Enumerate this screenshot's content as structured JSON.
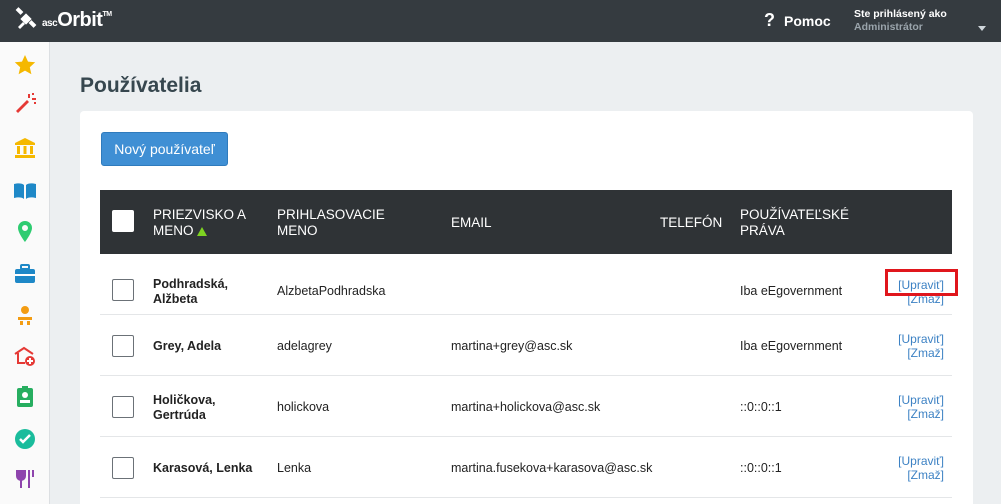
{
  "app": {
    "logo_prefix": "asc",
    "logo_main": "Orbit",
    "logo_tm": "TM"
  },
  "header": {
    "help_label": "Pomoc",
    "user_label": "Ste prihlásený ako",
    "user_name": "Administrátor"
  },
  "sidebar": {
    "items": [
      "star-icon",
      "magic-wand-icon",
      "bank-icon",
      "open-book-icon",
      "location-pin-icon",
      "briefcase-icon",
      "person-desk-icon",
      "school-add-icon",
      "id-badge-icon",
      "check-circle-icon",
      "cup-fork-icon"
    ]
  },
  "page": {
    "title": "Používatelia",
    "new_user_button": "Nový používateľ"
  },
  "table": {
    "headers": {
      "name": "PRIEZVISKO A MENO",
      "login": "PRIHLASOVACIE MENO",
      "email": "EMAIL",
      "phone": "TELEFÓN",
      "rights": "POUŽÍVATEĽSKÉ PRÁVA"
    },
    "rows": [
      {
        "name": "Podhradská, Alžbeta",
        "login": "AlzbetaPodhradska",
        "email": "",
        "phone": "",
        "rights": "Iba eEgovernment",
        "edit": "[Upraviť]",
        "delete": "[Zmaž]"
      },
      {
        "name": "Grey, Adela",
        "login": "adelagrey",
        "email": "martina+grey@asc.sk",
        "phone": "",
        "rights": "Iba eEgovernment",
        "edit": "[Upraviť]",
        "delete": "[Zmaž]"
      },
      {
        "name": "Holičkova, Gertrúda",
        "login": "holickova",
        "email": "martina+holickova@asc.sk",
        "phone": "",
        "rights": "::0::0::1",
        "edit": "[Upraviť]",
        "delete": "[Zmaž]"
      },
      {
        "name": "Karasová, Lenka",
        "login": "Lenka",
        "email": "martina.fusekova+karasova@asc.sk",
        "phone": "",
        "rights": "::0::0::1",
        "edit": "[Upraviť]",
        "delete": "[Zmaž]"
      }
    ]
  },
  "colors": {
    "topbar": "#353b40",
    "table_header": "#2f3336",
    "primary_button": "#3f8fd4",
    "link": "#3d82c4",
    "highlight": "#e0161c",
    "sort_arrow": "#7ed321"
  }
}
